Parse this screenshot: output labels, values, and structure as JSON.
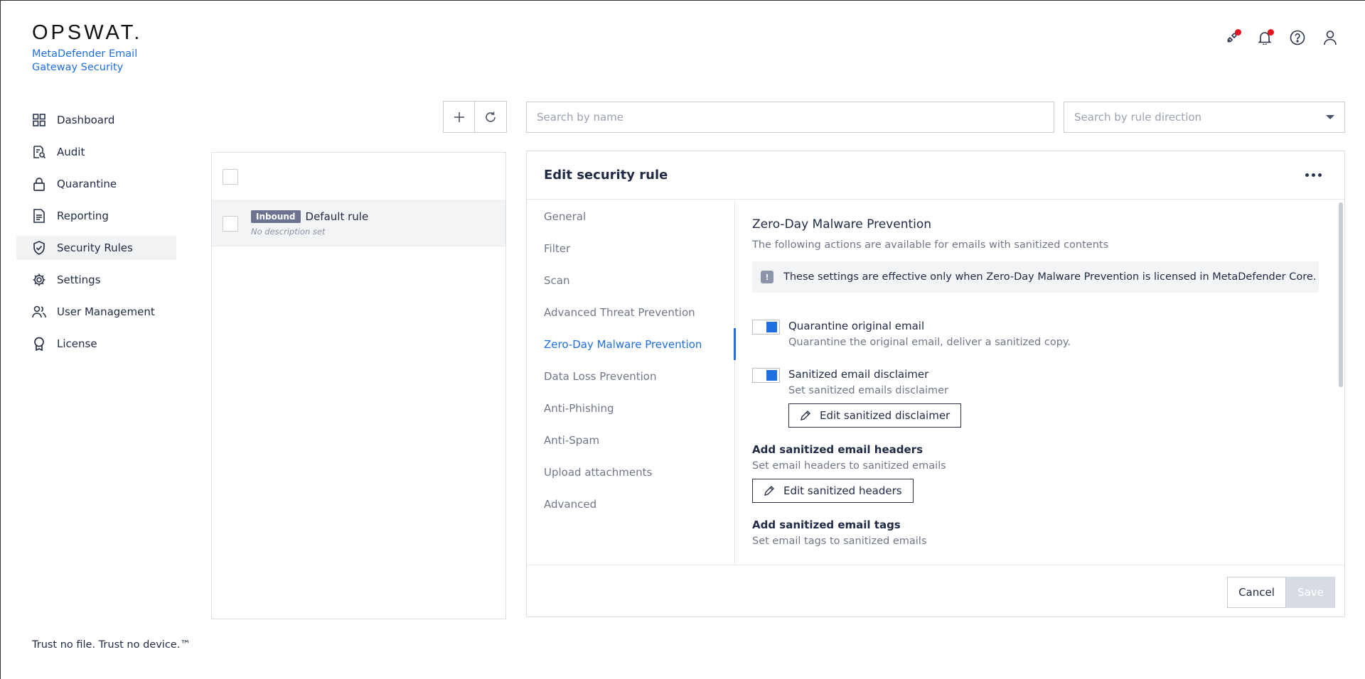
{
  "brand": {
    "logo": "OPSWAT.",
    "product": "MetaDefender Email Gateway Security"
  },
  "sidebar": {
    "items": [
      {
        "label": "Dashboard",
        "icon": "dashboard-icon"
      },
      {
        "label": "Audit",
        "icon": "audit-icon"
      },
      {
        "label": "Quarantine",
        "icon": "lock-icon"
      },
      {
        "label": "Reporting",
        "icon": "document-icon"
      },
      {
        "label": "Security Rules",
        "icon": "shield-check-icon",
        "active": true
      },
      {
        "label": "Settings",
        "icon": "gear-icon"
      },
      {
        "label": "User Management",
        "icon": "users-icon"
      },
      {
        "label": "License",
        "icon": "award-icon"
      }
    ],
    "tagline": "Trust no file. Trust no device.™"
  },
  "header": {
    "icons": [
      "plug-icon",
      "bell-icon",
      "help-icon",
      "user-icon"
    ],
    "accent": "#e3141f"
  },
  "rule_list": {
    "rows": [
      {
        "badge": "Inbound",
        "name": "Default rule",
        "description": "No description set"
      }
    ]
  },
  "search": {
    "name_placeholder": "Search by name",
    "direction_placeholder": "Search by rule direction"
  },
  "edit": {
    "title": "Edit security rule",
    "tabs": [
      "General",
      "Filter",
      "Scan",
      "Advanced Threat Prevention",
      "Zero-Day Malware Prevention",
      "Data Loss Prevention",
      "Anti-Phishing",
      "Anti-Spam",
      "Upload attachments",
      "Advanced"
    ],
    "active_tab": "Zero-Day Malware Prevention",
    "section_title": "Zero-Day Malware Prevention",
    "section_sub": "The following actions are available for emails with sanitized contents",
    "info": "These settings are effective only when Zero-Day Malware Prevention is licensed in MetaDefender Core.",
    "quarantine_title": "Quarantine original email",
    "quarantine_sub": "Quarantine the original email, deliver a sanitized copy.",
    "disclaimer_title": "Sanitized email disclaimer",
    "disclaimer_sub": "Set sanitized emails disclaimer",
    "disclaimer_btn": "Edit sanitized disclaimer",
    "headers_title": "Add sanitized email headers",
    "headers_sub": "Set email headers to sanitized emails",
    "headers_btn": "Edit sanitized headers",
    "tags_title": "Add sanitized email tags",
    "tags_sub": "Set email tags to sanitized emails",
    "cancel": "Cancel",
    "save": "Save"
  },
  "colors": {
    "accent": "#1f6fe0",
    "text": "#1f2a44",
    "muted": "#6f7789"
  }
}
